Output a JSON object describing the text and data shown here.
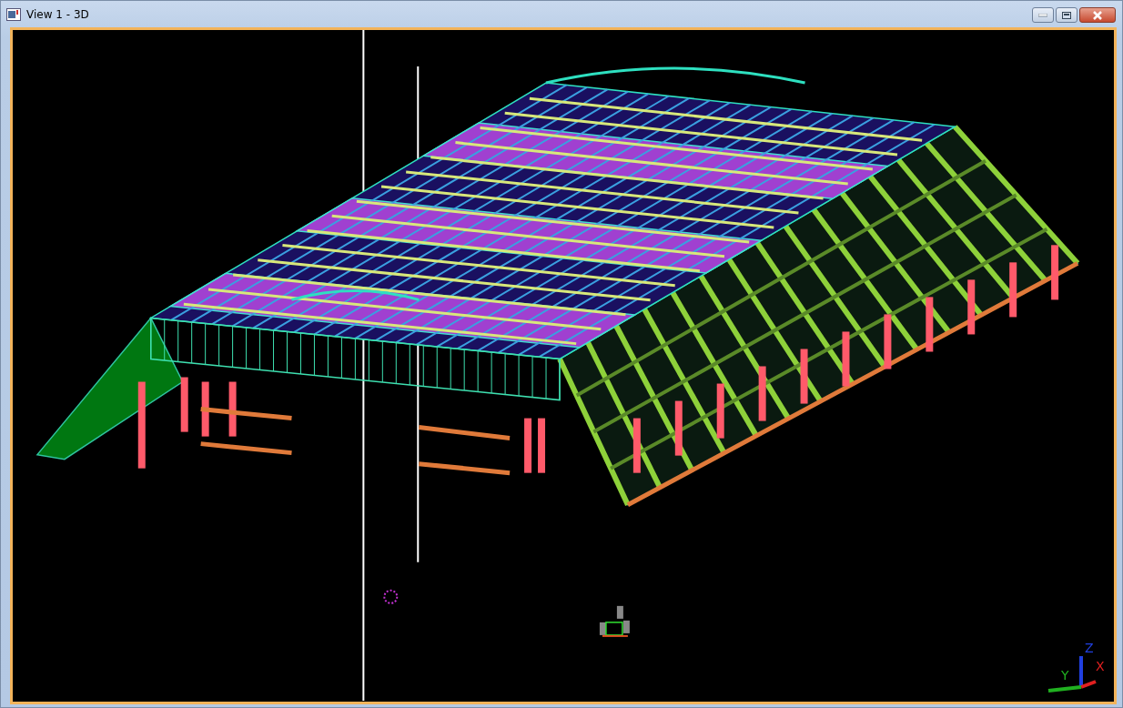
{
  "window": {
    "title": "View 1 - 3D"
  },
  "view_cube": {
    "axes": [
      {
        "label": "Z",
        "color": "#2040e0"
      },
      {
        "label": "X",
        "color": "#e02020"
      },
      {
        "label": "Y",
        "color": "#20b020"
      }
    ]
  }
}
